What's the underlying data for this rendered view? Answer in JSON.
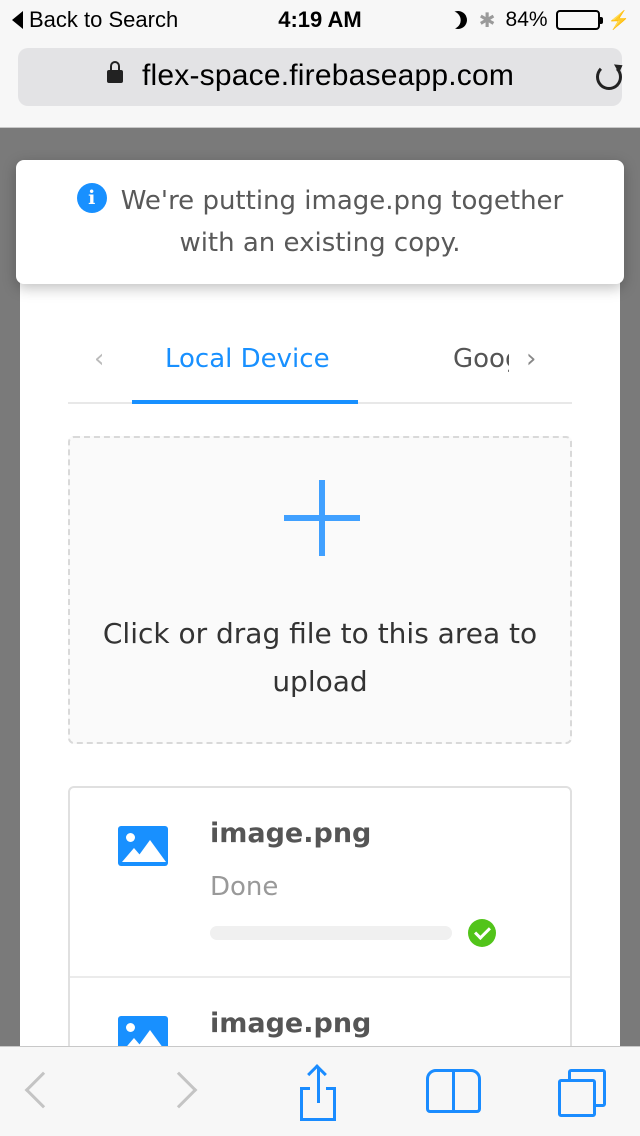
{
  "status_bar": {
    "back_label": "Back to Search",
    "time": "4:19 AM",
    "bluetooth_glyph": "✱",
    "battery": "84%",
    "battery_level": 0.84,
    "charging_glyph": "⚡"
  },
  "browser": {
    "url": "flex-space.firebaseapp.com"
  },
  "notice": {
    "icon_glyph": "i",
    "line1": "We're putting image.png together",
    "line2": "with an existing copy."
  },
  "tabs": {
    "prev_glyph": "‹",
    "next_glyph": "›",
    "items": [
      {
        "label": "Local Device",
        "active": true
      },
      {
        "label": "Google Drive",
        "active": false
      }
    ]
  },
  "dropzone": {
    "text": "Click or drag file to this area to upload"
  },
  "files": [
    {
      "name": "image.png",
      "status": "Done",
      "progress": 1.0
    },
    {
      "name": "image.png"
    }
  ],
  "colors": {
    "accent": "#1890ff",
    "success": "#52c41a",
    "ios_blue": "#1a8cff"
  },
  "icons": {
    "toolbar": [
      "back-chevron-icon",
      "forward-chevron-icon",
      "share-icon",
      "bookmarks-icon",
      "tabs-icon"
    ]
  }
}
